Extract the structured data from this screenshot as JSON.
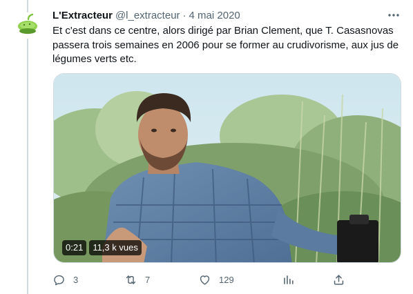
{
  "tweet": {
    "author_name": "L'Extracteur",
    "handle": "@l_extracteur",
    "separator": "·",
    "date": "4 mai 2020",
    "text": "Et c'est dans ce centre, alors dirigé par Brian Clement, que T. Casasnovas passera trois semaines en 2006 pour se former au crudivorisme, aux jus de légumes verts etc."
  },
  "media": {
    "type": "video",
    "duration": "0:21",
    "views": "11,3 k vues"
  },
  "actions": {
    "reply": {
      "icon": "reply-icon",
      "count": "3"
    },
    "retweet": {
      "icon": "retweet-icon",
      "count": "7"
    },
    "like": {
      "icon": "heart-icon",
      "count": "129"
    },
    "analytics": {
      "icon": "analytics-icon"
    },
    "share": {
      "icon": "share-icon"
    }
  },
  "colors": {
    "text_primary": "#0f1419",
    "text_secondary": "#536471",
    "border": "#cfd9de",
    "background": "#ffffff"
  }
}
